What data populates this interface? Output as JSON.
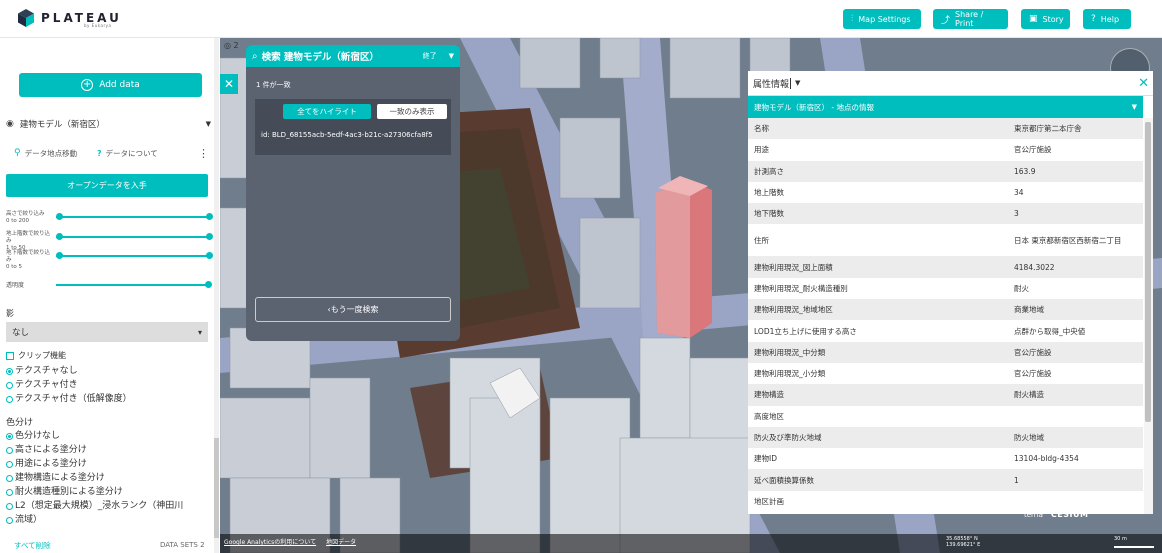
{
  "app": {
    "logo_text": "PLATEAU",
    "logo_sub": "by Eukarya"
  },
  "topbar": {
    "map_settings": "Map Settings",
    "share_print": "Share / Print",
    "story": "Story",
    "help": "Help",
    "accent": "#00bebe"
  },
  "sidebar": {
    "add_data": "Add data",
    "layer_name": "建物モデル（新宿区）",
    "action_move": "データ地点移動",
    "action_about": "データについて",
    "open_data": "オープンデータを入手",
    "filters": [
      {
        "label": "高さで絞り込み",
        "range": "0 to 200",
        "min_fraction": 0,
        "max_fraction": 1
      },
      {
        "label": "地上階数で絞り込み",
        "range": "1 to 50",
        "min_fraction": 0,
        "max_fraction": 1
      },
      {
        "label": "地下階数で絞り込み",
        "range": "0 to 5",
        "min_fraction": 0,
        "max_fraction": 1
      }
    ],
    "opacity_label": "透明度",
    "opacity_fraction": 1,
    "shadow_label": "影",
    "shadow_value": "なし",
    "clip_label": "クリップ機能",
    "texture_options": [
      {
        "label": "テクスチャなし",
        "checked": true
      },
      {
        "label": "テクスチャ付き",
        "checked": false
      },
      {
        "label": "テクスチャ付き（低解像度）",
        "checked": false
      }
    ],
    "color_label": "色分け",
    "color_options": [
      {
        "label": "色分けなし",
        "checked": true
      },
      {
        "label": "高さによる塗分け",
        "checked": false
      },
      {
        "label": "用途による塗分け",
        "checked": false
      },
      {
        "label": "建物構造による塗分け",
        "checked": false
      },
      {
        "label": "耐火構造種別による塗分け",
        "checked": false
      },
      {
        "label": "L2（想定最大規模）_浸水ランク（神田川",
        "checked": false
      },
      {
        "label": "流域）",
        "checked": false
      }
    ],
    "remove_all": "すべて削除",
    "datasets": "DATA SETS 2"
  },
  "map": {
    "footer_links": [
      "Google Analyticsの利用について",
      "地図データ"
    ],
    "lat": "35.68558° N",
    "lon": "139.69621° E",
    "scale": "30 m",
    "credit_terria": "terria",
    "credit_cesium": "CESIUM",
    "top_status": "2"
  },
  "search": {
    "title": "検索 建物モデル（新宿区）",
    "end": "終了",
    "count": "1 件が一致",
    "highlight_all": "全てをハイライト",
    "show_only": "一致のみ表示",
    "result_id": "id: BLD_68155acb-5edf-4ac3-b21c-a27306cfa8f5",
    "research": "もう一度検索"
  },
  "attributes": {
    "selector": "属性情報",
    "section": "建物モデル（新宿区） - 地点の情報",
    "rows": [
      {
        "k": "名称",
        "v": "東京都庁第二本庁舎"
      },
      {
        "k": "用途",
        "v": "官公庁施設"
      },
      {
        "k": "計測高さ",
        "v": "163.9"
      },
      {
        "k": "地上階数",
        "v": "34"
      },
      {
        "k": "地下階数",
        "v": "3"
      },
      {
        "k": "住所",
        "v": "日本 東京都新宿区西新宿二丁目",
        "tall": true
      },
      {
        "k": "建物利用現況_図上面積",
        "v": "4184.3022"
      },
      {
        "k": "建物利用現況_耐火構造種別",
        "v": "耐火"
      },
      {
        "k": "建物利用現況_地域地区",
        "v": "商業地域"
      },
      {
        "k": "LOD1立ち上げに使用する高さ",
        "v": "点群から取得_中央値"
      },
      {
        "k": "建物利用現況_中分類",
        "v": "官公庁施設"
      },
      {
        "k": "建物利用現況_小分類",
        "v": "官公庁施設"
      },
      {
        "k": "建物構造",
        "v": "耐火構造"
      },
      {
        "k": "高度地区",
        "v": ""
      },
      {
        "k": "防火及び準防火地域",
        "v": "防火地域"
      },
      {
        "k": "建物ID",
        "v": "13104-bldg-4354"
      },
      {
        "k": "延べ面積換算係数",
        "v": "1"
      },
      {
        "k": "地区計画",
        "v": ""
      }
    ]
  }
}
